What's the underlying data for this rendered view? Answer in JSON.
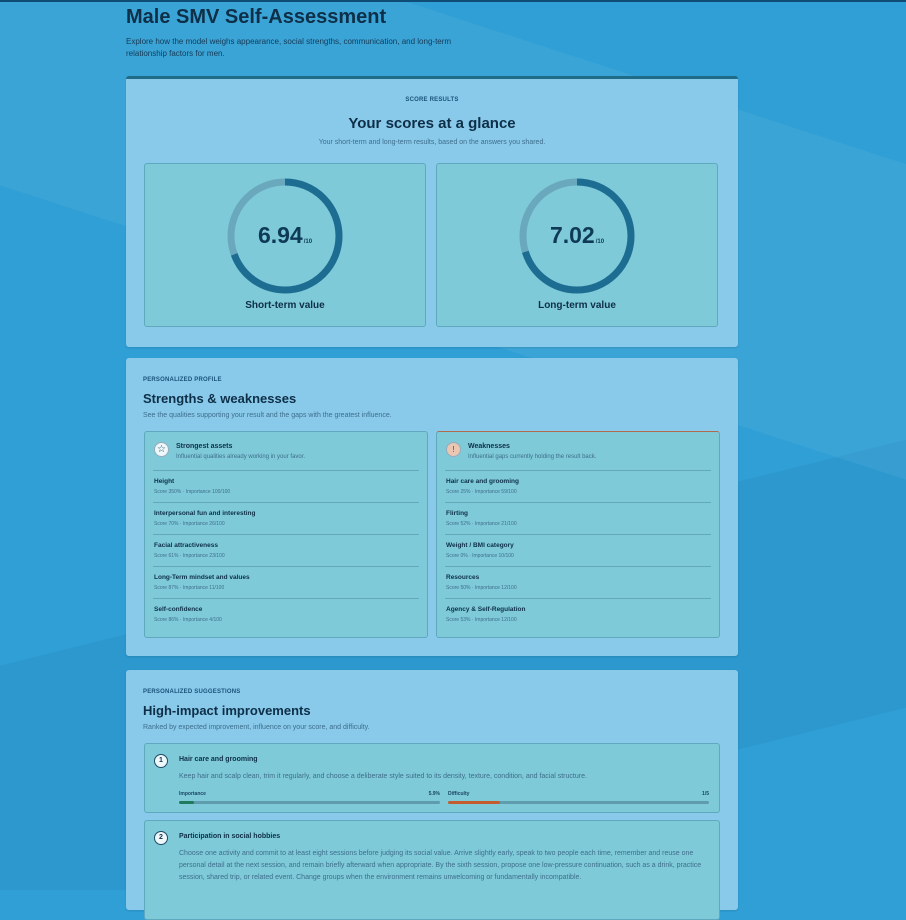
{
  "page": {
    "title": "Male SMV Self-Assessment",
    "description": "Explore how the model weighs appearance, social strengths, communication, and long-term relationship factors for men."
  },
  "scores": {
    "eyebrow": "SCORE RESULTS",
    "title": "Your scores at a glance",
    "subtitle": "Your short-term and long-term results, based on the answers you shared.",
    "short_term": {
      "value": "6.94",
      "value_num": 6.94,
      "max": "/10",
      "label": "Short-term value"
    },
    "long_term": {
      "value": "7.02",
      "value_num": 7.02,
      "max": "/10",
      "label": "Long-term value"
    },
    "colors": {
      "ring_fill": "#1d6d93",
      "ring_track": "#6aa9bd"
    }
  },
  "profile": {
    "eyebrow": "PERSONALIZED PROFILE",
    "title": "Strengths & weaknesses",
    "subtitle": "See the qualities supporting your result and the gaps with the greatest influence.",
    "strengths": {
      "icon": "star-icon",
      "glyph": "☆",
      "title": "Strongest assets",
      "subtitle": "Influential qualities already working in your favor.",
      "items": [
        {
          "name": "Height",
          "meta": "Score 350% · Importance 100/100"
        },
        {
          "name": "Interpersonal fun and interesting",
          "meta": "Score 70% · Importance 26/100"
        },
        {
          "name": "Facial attractiveness",
          "meta": "Score 61% · Importance 23/100"
        },
        {
          "name": "Long-Term mindset and values",
          "meta": "Score 87% · Importance 11/100"
        },
        {
          "name": "Self-confidence",
          "meta": "Score 86% · Importance 4/100"
        }
      ]
    },
    "weaknesses": {
      "icon": "alert-icon",
      "glyph": "!",
      "title": "Weaknesses",
      "subtitle": "Influential gaps currently holding the result back.",
      "items": [
        {
          "name": "Hair care and grooming",
          "meta": "Score 25% · Importance 59/100"
        },
        {
          "name": "Flirting",
          "meta": "Score 52% · Importance 21/100"
        },
        {
          "name": "Weight / BMI category",
          "meta": "Score 0% · Importance 10/100"
        },
        {
          "name": "Resources",
          "meta": "Score 50% · Importance 12/100"
        },
        {
          "name": "Agency & Self-Regulation",
          "meta": "Score 53% · Importance 12/100"
        }
      ]
    }
  },
  "suggestions": {
    "eyebrow": "PERSONALIZED SUGGESTIONS",
    "title": "High-impact improvements",
    "subtitle": "Ranked by expected improvement, influence on your score, and difficulty.",
    "items": [
      {
        "number": "1",
        "title": "Hair care and grooming",
        "description": "Keep hair and scalp clean, trim it regularly, and choose a deliberate style suited to its density, texture, condition, and facial structure.",
        "importance_label": "Importance",
        "importance_value": "5.9%",
        "importance_fraction": 0.059,
        "difficulty_label": "Difficulty",
        "difficulty_value": "1/5",
        "difficulty_fraction": 0.2
      },
      {
        "number": "2",
        "title": "Participation in social hobbies",
        "description": "Choose one activity and commit to at least eight sessions before judging its social value. Arrive slightly early, speak to two people each time, remember and reuse one personal detail at the next session, and remain briefly afterward when appropriate. By the sixth session, propose one low-pressure continuation, such as a drink, practice session, shared trip, or related event. Change groups when the environment remains unwelcoming or fundamentally incompatible."
      }
    ]
  }
}
